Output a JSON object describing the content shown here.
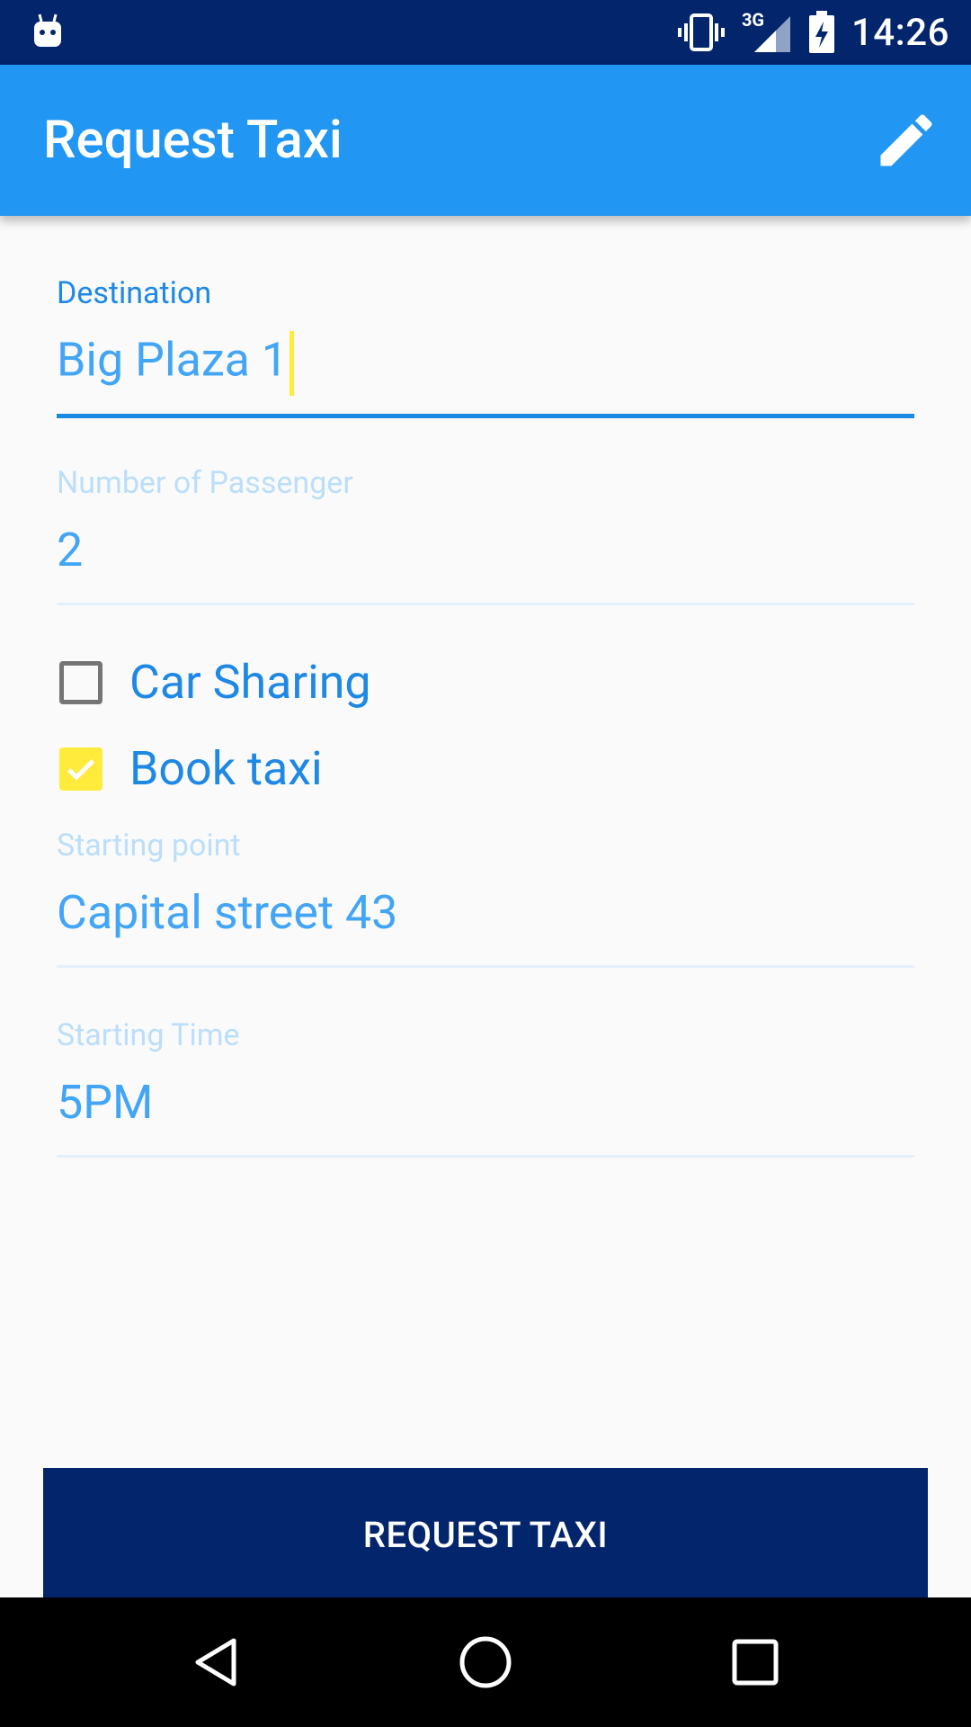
{
  "status_bar": {
    "time": "14:26",
    "network": "3G"
  },
  "app_bar": {
    "title": "Request Taxi"
  },
  "form": {
    "destination": {
      "label": "Destination",
      "value": "Big Plaza 1"
    },
    "passengers": {
      "label": "Number of Passenger",
      "value": "2"
    },
    "car_sharing": {
      "label": "Car Sharing",
      "checked": false
    },
    "book_taxi": {
      "label": "Book taxi",
      "checked": true
    },
    "starting_point": {
      "label": "Starting point",
      "value": "Capital street 43"
    },
    "starting_time": {
      "label": "Starting Time",
      "value": "5PM"
    }
  },
  "submit": {
    "label": "REQUEST TAXI"
  },
  "colors": {
    "primary": "#2196f3",
    "primary_dark": "#03256c",
    "accent": "#ffeb3b"
  }
}
